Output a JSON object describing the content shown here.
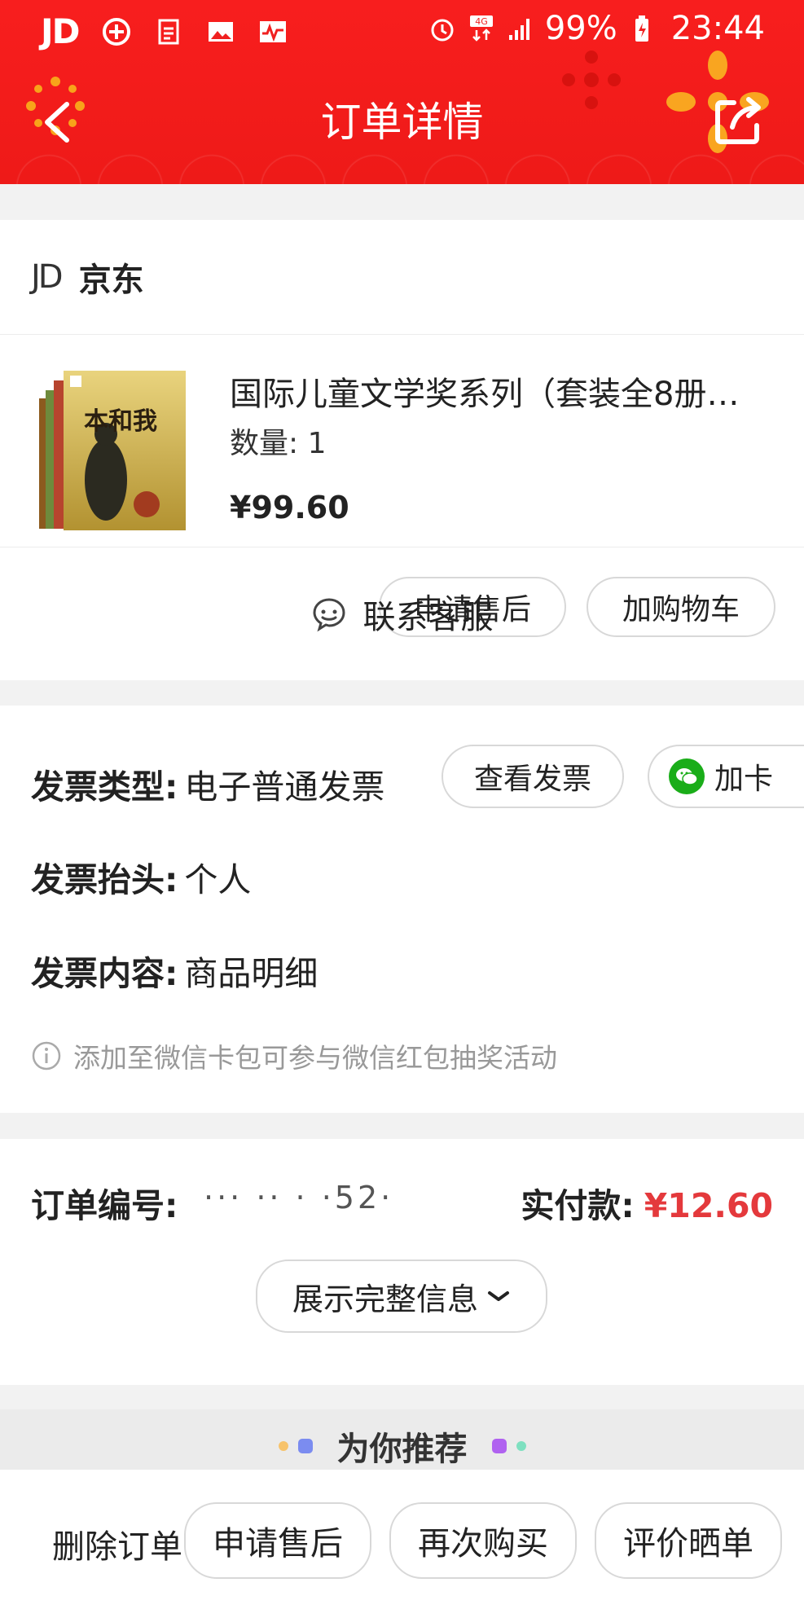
{
  "status_bar": {
    "carrier_logo": "JD",
    "icons": [
      "plus-circle-icon",
      "document-icon",
      "image-icon",
      "activity-icon"
    ],
    "right_icons": [
      "alarm-icon",
      "4g-icon",
      "signal-icon",
      "battery-icon"
    ],
    "battery": "99%",
    "time": "23:44"
  },
  "nav": {
    "title": "订单详情",
    "back_icon": "back-icon",
    "share_icon": "share-icon"
  },
  "shop": {
    "logo": "JD",
    "name": "京东"
  },
  "product": {
    "title": "国际儿童文学奖系列（套装全8册…",
    "quantity": "数量: 1",
    "price": "¥99.60",
    "cover_text": "本和我",
    "buttons": [
      "申请售后",
      "加购物车"
    ]
  },
  "service": {
    "icon": "customer-service-icon",
    "label": "联系客服"
  },
  "invoice": {
    "type_key": "发票类型:",
    "type_val": "电子普通发票",
    "title_key": "发票抬头:",
    "title_val": "个人",
    "content_key": "发票内容:",
    "content_val": "商品明细",
    "view_button": "查看发票",
    "wechat_button": "加卡",
    "note": "添加至微信卡包可参与微信红包抽奖活动"
  },
  "order": {
    "number_key": "订单编号:",
    "number_val": "··· ·· ·   ·52·",
    "paid_key": "实付款:",
    "paid_val": "¥12.60",
    "expand_label": "展示完整信息"
  },
  "recommend": {
    "title": "为你推荐"
  },
  "bottom_bar": {
    "delete_label": "删除订单",
    "buttons": [
      "申请售后",
      "再次购买",
      "评价晒单"
    ]
  },
  "colors": {
    "header_red": "#f81e1e",
    "price_red": "#e4393c",
    "wechat_green": "#1aad19"
  }
}
